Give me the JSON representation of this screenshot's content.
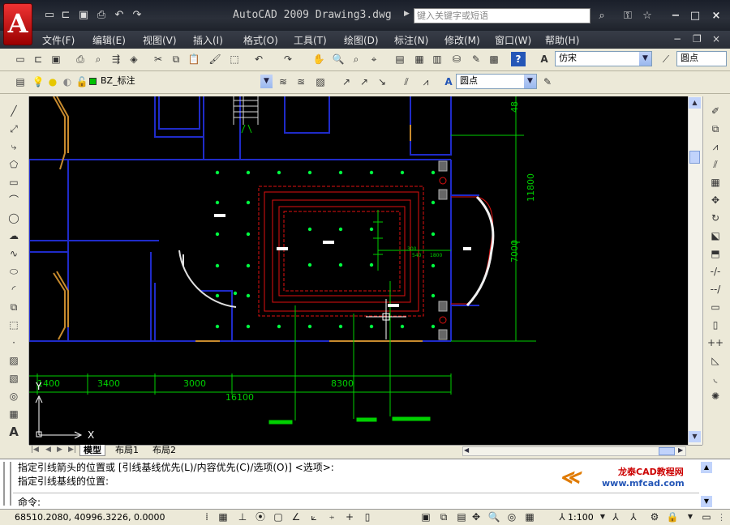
{
  "title_bar": {
    "app_title": "AutoCAD 2009 Drawing3.dwg",
    "logo_letter": "A",
    "search_placeholder": "键入关键字或短语"
  },
  "quick_access": [
    "new",
    "open",
    "save",
    "print",
    "undo",
    "redo"
  ],
  "menu": [
    "文件(F)",
    "编辑(E)",
    "视图(V)",
    "插入(I)",
    "格式(O)",
    "工具(T)",
    "绘图(D)",
    "标注(N)",
    "修改(M)",
    "窗口(W)",
    "帮助(H)"
  ],
  "toolbar": {
    "text_style": "仿宋",
    "dim_style": "圆点",
    "layer": "BZ_标注",
    "leader_style": "圆点"
  },
  "drawing": {
    "dims_bottom": [
      "1400",
      "3400",
      "3000",
      "8300",
      "16100"
    ],
    "dims_right": [
      "48",
      "11800",
      "7000"
    ],
    "small_dims": [
      "300",
      "540",
      "1800"
    ],
    "ucs_x": "X",
    "ucs_y": "Y"
  },
  "layout_tabs": [
    "模型",
    "布局1",
    "布局2"
  ],
  "command": {
    "line1": "指定引线箭头的位置或 [引线基线优先(L)/内容优先(C)/选项(O)] <选项>:",
    "line2": "指定引线基线的位置:",
    "prompt": "命令:",
    "watermark_site": "www.mfcad.com",
    "watermark_brand": "龙泰CAD教程网"
  },
  "status": {
    "coordinates": "68510.2080, 40996.3226, 0.0000",
    "scale": "1:100"
  },
  "colors": {
    "wall": "#1f2bc9",
    "red_line": "#e01010",
    "dim": "#00d000",
    "light": "#00ff40"
  }
}
